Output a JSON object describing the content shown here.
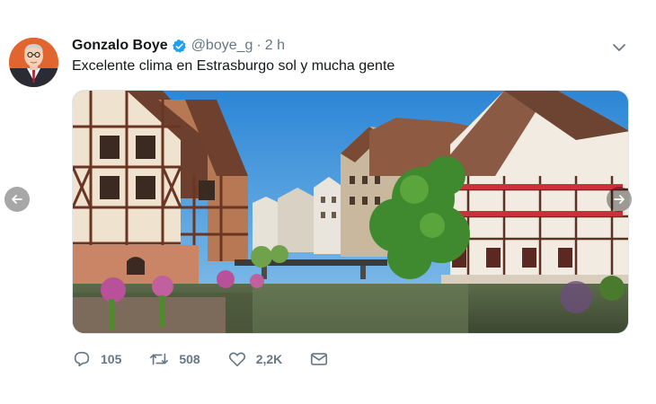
{
  "tweet": {
    "author_name": "Gonzalo Boye",
    "handle": "@boye_g",
    "separator": "·",
    "time": "2 h",
    "text": "Excelente clima en Estrasburgo sol y mucha gente",
    "verified": true
  },
  "actions": {
    "replies": "105",
    "retweets": "508",
    "likes": "2,2K"
  },
  "colors": {
    "brand_blue": "#1da1f2",
    "muted": "#657786",
    "text": "#14171a"
  },
  "icons": {
    "avatar": "avatar-illustration",
    "verified": "verified-badge-icon",
    "caret": "chevron-down-icon",
    "prev": "arrow-left-icon",
    "next": "arrow-right-icon",
    "reply": "reply-icon",
    "retweet": "retweet-icon",
    "like": "heart-icon",
    "message": "envelope-icon"
  }
}
